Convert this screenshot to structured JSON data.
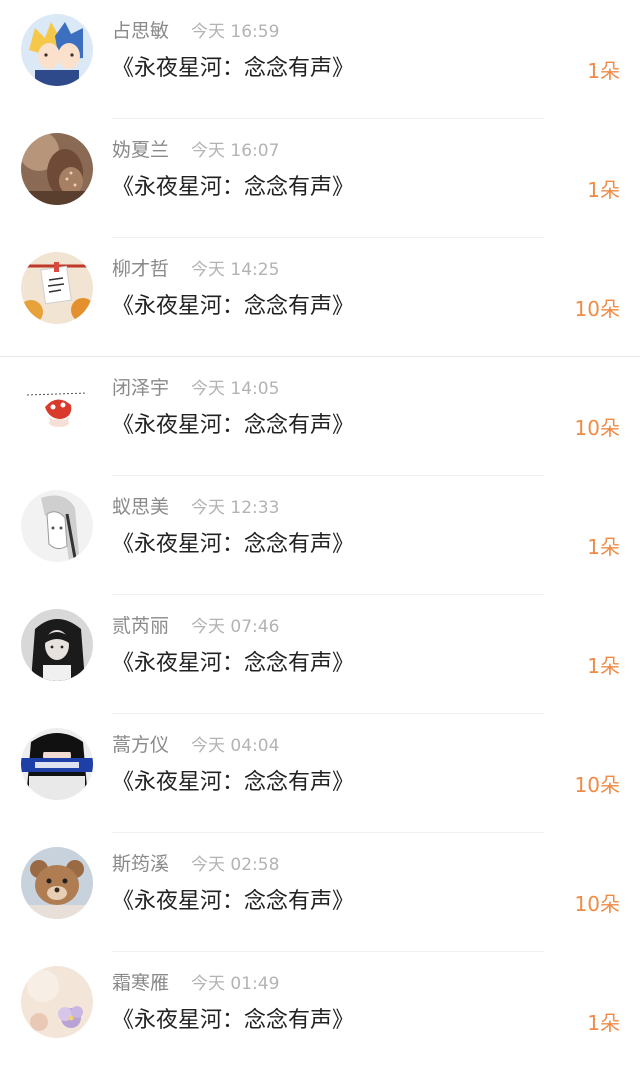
{
  "messages": [
    {
      "sender": "占思敏",
      "time": "今天 16:59",
      "book_title": "《永夜星河：念念有声》",
      "gift_count": "1朵",
      "avatar": "anime-couple"
    },
    {
      "sender": "妫夏兰",
      "time": "今天 16:07",
      "book_title": "《永夜星河：念念有声》",
      "gift_count": "1朵",
      "avatar": "sepia-photo"
    },
    {
      "sender": "柳才哲",
      "time": "今天 14:25",
      "book_title": "《永夜星河：念念有声》",
      "gift_count": "10朵",
      "avatar": "love-you-note"
    },
    {
      "sender": "闭泽宇",
      "time": "今天 14:05",
      "book_title": "《永夜星河：念念有声》",
      "gift_count": "10朵",
      "avatar": "cartoon-red"
    },
    {
      "sender": "蚁思美",
      "time": "今天 12:33",
      "book_title": "《永夜星河：念念有声》",
      "gift_count": "1朵",
      "avatar": "sketch-girl"
    },
    {
      "sender": "贰芮丽",
      "time": "今天 07:46",
      "book_title": "《永夜星河：念念有声》",
      "gift_count": "1朵",
      "avatar": "dark-hair-girl"
    },
    {
      "sender": "蒿方仪",
      "time": "今天 04:04",
      "book_title": "《永夜星河：念念有声》",
      "gift_count": "10朵",
      "avatar": "black-hair-banner"
    },
    {
      "sender": "斯筠溪",
      "time": "今天 02:58",
      "book_title": "《永夜星河：念念有声》",
      "gift_count": "10朵",
      "avatar": "teddy-bear"
    },
    {
      "sender": "霜寒雁",
      "time": "今天 01:49",
      "book_title": "《永夜星河：念念有声》",
      "gift_count": "1朵",
      "avatar": "pastel-flower"
    }
  ],
  "colors": {
    "accent": "#ef8b46",
    "name_text": "#8a8a8a",
    "time_text": "#b3b3b3",
    "title_text": "#222222",
    "divider": "#f0f0f0"
  }
}
